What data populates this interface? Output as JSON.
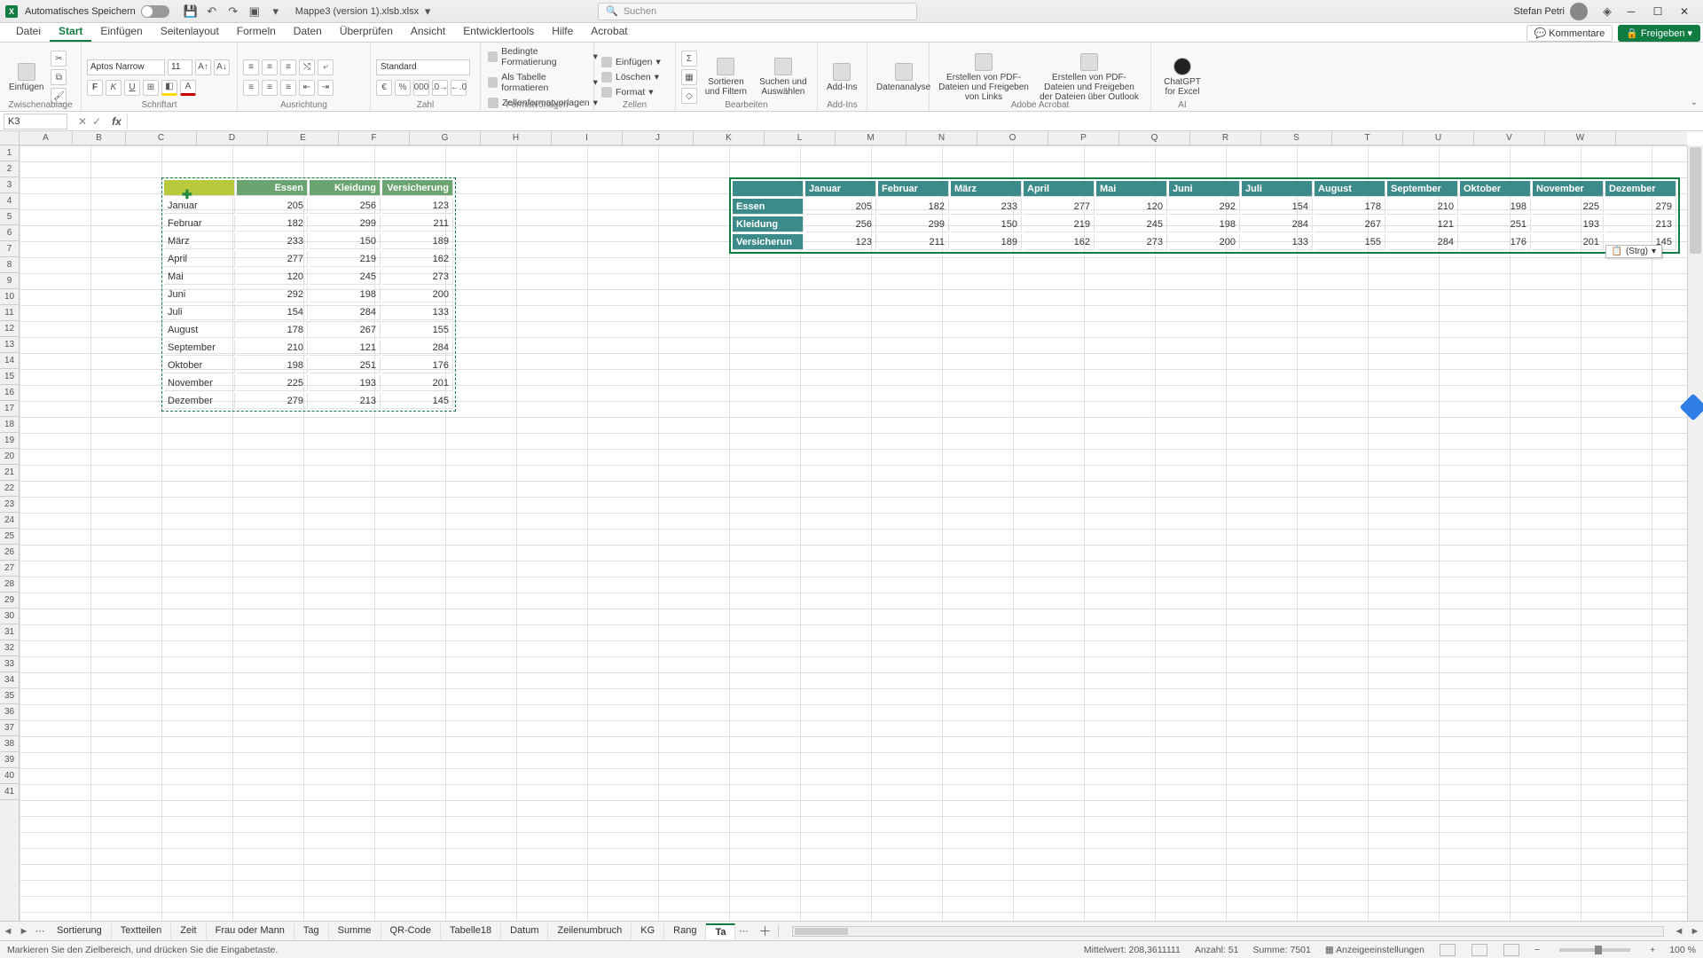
{
  "titlebar": {
    "autosave": "Automatisches Speichern",
    "docname": "Mappe3 (version 1).xlsb.xlsx",
    "search_placeholder": "Suchen",
    "user": "Stefan Petri"
  },
  "tabs": {
    "items": [
      "Datei",
      "Start",
      "Einfügen",
      "Seitenlayout",
      "Formeln",
      "Daten",
      "Überprüfen",
      "Ansicht",
      "Entwicklertools",
      "Hilfe",
      "Acrobat"
    ],
    "active": 1,
    "comments": "Kommentare",
    "share": "Freigeben"
  },
  "ribbon": {
    "clipboard": {
      "paste": "Einfügen",
      "label": "Zwischenablage"
    },
    "font": {
      "name": "Aptos Narrow",
      "size": "11",
      "bold": "F",
      "italic": "K",
      "underline": "U",
      "label": "Schriftart"
    },
    "align": {
      "label": "Ausrichtung"
    },
    "number": {
      "format": "Standard",
      "label": "Zahl"
    },
    "styles": {
      "cond": "Bedingte Formatierung",
      "astable": "Als Tabelle formatieren",
      "cellstyles": "Zellenformatvorlagen",
      "label": "Formatvorlagen"
    },
    "cells": {
      "insert": "Einfügen",
      "delete": "Löschen",
      "format": "Format",
      "label": "Zellen"
    },
    "editing": {
      "sortfilter": "Sortieren und Filtern",
      "findselect": "Suchen und Auswählen",
      "label": "Bearbeiten"
    },
    "addins": {
      "addins": "Add-Ins",
      "label": "Add-Ins"
    },
    "analysis": {
      "data": "Datenanalyse"
    },
    "acrobat": {
      "pdf1": "Erstellen von PDF-Dateien und Freigeben von Links",
      "pdf2": "Erstellen von PDF-Dateien und Freigeben der Dateien über Outlook",
      "label": "Adobe Acrobat"
    },
    "ai": {
      "chatgpt": "ChatGPT for Excel",
      "label": "AI"
    }
  },
  "namebox": "K3",
  "columns": [
    "A",
    "B",
    "C",
    "D",
    "E",
    "F",
    "G",
    "H",
    "I",
    "J",
    "K",
    "L",
    "M",
    "N",
    "O",
    "P",
    "Q",
    "R",
    "S",
    "T",
    "U",
    "V",
    "W"
  ],
  "rowcount": 41,
  "table1": {
    "headers": [
      "",
      "Essen",
      "Kleidung",
      "Versicherung"
    ],
    "rows": [
      [
        "Januar",
        205,
        256,
        123
      ],
      [
        "Februar",
        182,
        299,
        211
      ],
      [
        "März",
        233,
        150,
        189
      ],
      [
        "April",
        277,
        219,
        162
      ],
      [
        "Mai",
        120,
        245,
        273
      ],
      [
        "Juni",
        292,
        198,
        200
      ],
      [
        "Juli",
        154,
        284,
        133
      ],
      [
        "August",
        178,
        267,
        155
      ],
      [
        "September",
        210,
        121,
        284
      ],
      [
        "Oktober",
        198,
        251,
        176
      ],
      [
        "November",
        225,
        193,
        201
      ],
      [
        "Dezember",
        279,
        213,
        145
      ]
    ]
  },
  "table2": {
    "headers": [
      "",
      "Januar",
      "Februar",
      "März",
      "April",
      "Mai",
      "Juni",
      "Juli",
      "August",
      "September",
      "Oktober",
      "November",
      "Dezember"
    ],
    "rows": [
      [
        "Essen",
        205,
        182,
        233,
        277,
        120,
        292,
        154,
        178,
        210,
        198,
        225,
        279
      ],
      [
        "Kleidung",
        256,
        299,
        150,
        219,
        245,
        198,
        284,
        267,
        121,
        251,
        193,
        213
      ],
      [
        "Versicherun",
        123,
        211,
        189,
        162,
        273,
        200,
        133,
        155,
        284,
        176,
        201,
        145
      ]
    ]
  },
  "paste_badge": "(Strg)",
  "sheets": {
    "items": [
      "Sortierung",
      "Textteilen",
      "Zeit",
      "Frau oder Mann",
      "Tag",
      "Summe",
      "QR-Code",
      "Tabelle18",
      "Datum",
      "Zeilenumbruch",
      "KG",
      "Rang",
      "Ta"
    ],
    "active": 12
  },
  "status": {
    "hint": "Markieren Sie den Zielbereich, und drücken Sie die Eingabetaste.",
    "mean_label": "Mittelwert:",
    "mean": "208,3611111",
    "count_label": "Anzahl:",
    "count": "51",
    "sum_label": "Summe:",
    "sum": "7501",
    "display": "Anzeigeeinstellungen",
    "zoom": "100 %"
  }
}
